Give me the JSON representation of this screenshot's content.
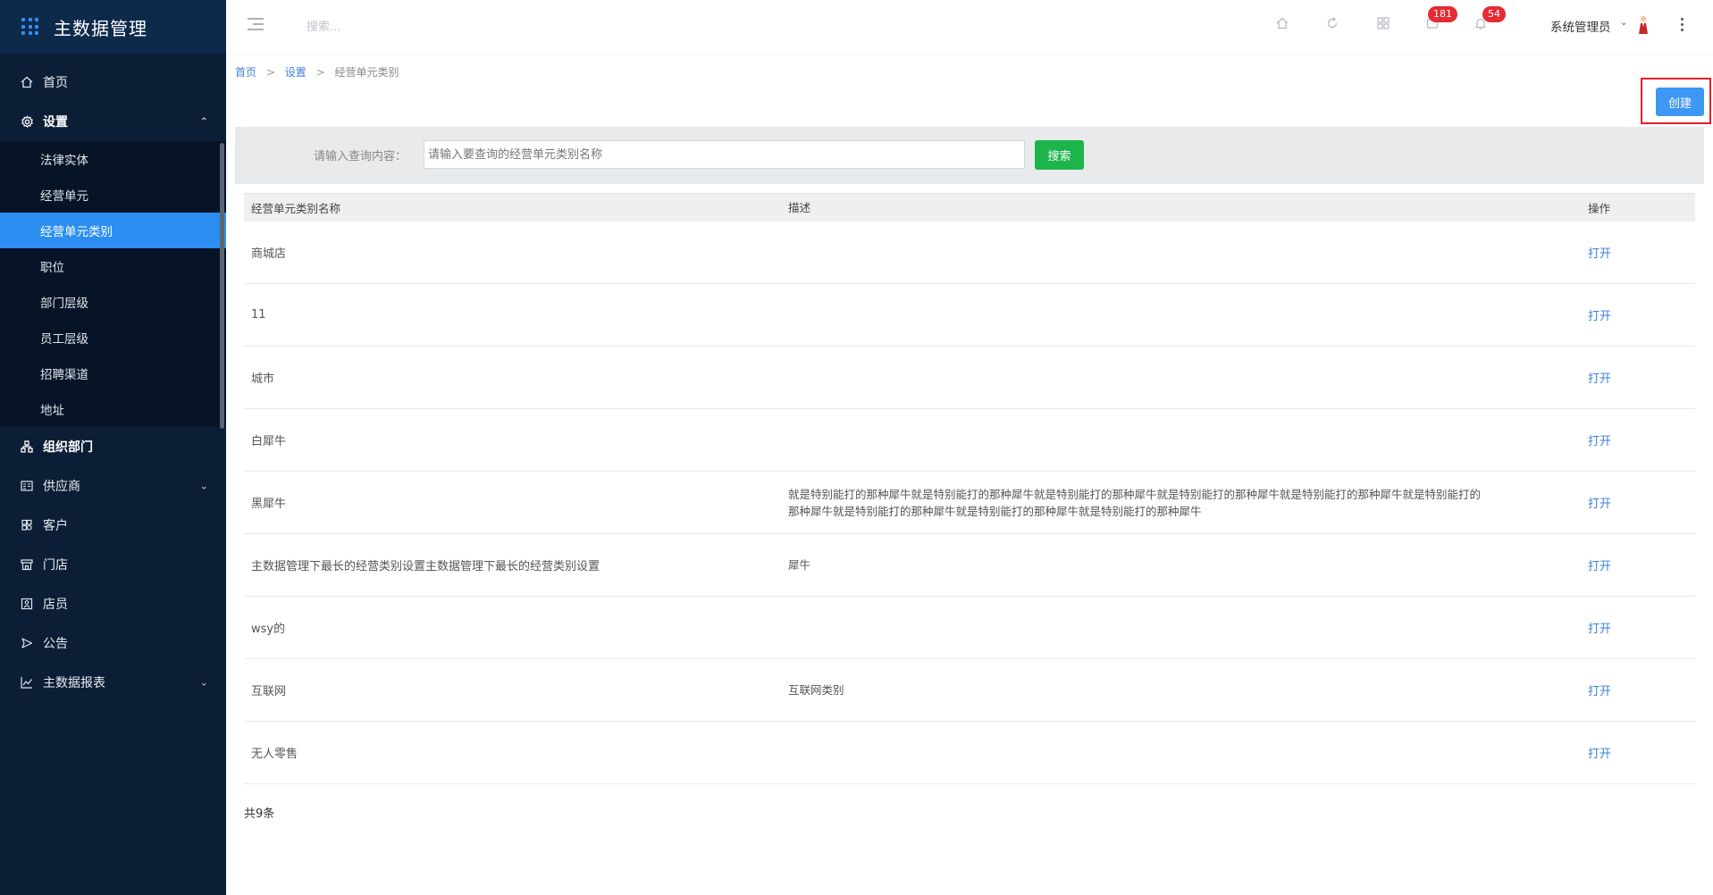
{
  "app": {
    "title": "主数据管理"
  },
  "sidebar": {
    "items": [
      {
        "label": "首页",
        "icon": "home-icon"
      },
      {
        "label": "设置",
        "icon": "gear-icon",
        "expanded": true
      },
      {
        "label": "组织部门",
        "icon": "org-icon"
      },
      {
        "label": "供应商",
        "icon": "supplier-icon"
      },
      {
        "label": "客户",
        "icon": "customer-icon"
      },
      {
        "label": "门店",
        "icon": "store-icon"
      },
      {
        "label": "店员",
        "icon": "clerk-icon"
      },
      {
        "label": "公告",
        "icon": "announce-icon"
      },
      {
        "label": "主数据报表",
        "icon": "chart-icon"
      }
    ],
    "sub_items": [
      "法律实体",
      "经营单元",
      "经营单元类别",
      "职位",
      "部门层级",
      "员工层级",
      "招聘渠道",
      "地址"
    ],
    "active_sub": "经营单元类别"
  },
  "header": {
    "search_placeholder": "搜索...",
    "badge_messages": "181",
    "badge_notifications": "54",
    "user": "系统管理员"
  },
  "breadcrumb": {
    "home": "首页",
    "settings": "设置",
    "current": "经营单元类别",
    "sep": ">"
  },
  "toolbar": {
    "create_label": "创建"
  },
  "search": {
    "label": "请输入查询内容：",
    "placeholder": "请输入要查询的经营单元类别名称",
    "button": "搜索"
  },
  "table": {
    "columns": [
      "经营单元类别名称",
      "描述",
      "操作"
    ],
    "rows": [
      {
        "name": "商城店",
        "desc": "",
        "action": "打开"
      },
      {
        "name": "11",
        "desc": "",
        "action": "打开"
      },
      {
        "name": "城市",
        "desc": "",
        "action": "打开"
      },
      {
        "name": "白犀牛",
        "desc": "",
        "action": "打开"
      },
      {
        "name": "黑犀牛",
        "desc": "就是特别能打的那种犀牛就是特别能打的那种犀牛就是特别能打的那种犀牛就是特别能打的那种犀牛就是特别能打的那种犀牛就是特别能打的那种犀牛就是特别能打的那种犀牛就是特别能打的那种犀牛就是特别能打的那种犀牛",
        "action": "打开"
      },
      {
        "name": "主数据管理下最长的经营类别设置主数据管理下最长的经营类别设置",
        "desc": "犀牛",
        "action": "打开"
      },
      {
        "name": "wsy的",
        "desc": "",
        "action": "打开"
      },
      {
        "name": "互联网",
        "desc": "互联网类别",
        "action": "打开"
      },
      {
        "name": "无人零售",
        "desc": "",
        "action": "打开"
      }
    ],
    "total": "共9条"
  },
  "colors": {
    "sidebar_bg": "#0c1e36",
    "accent": "#2b8ef0",
    "search_btn": "#1db44c",
    "badge": "#e52b33",
    "highlight": "#e0202c"
  }
}
